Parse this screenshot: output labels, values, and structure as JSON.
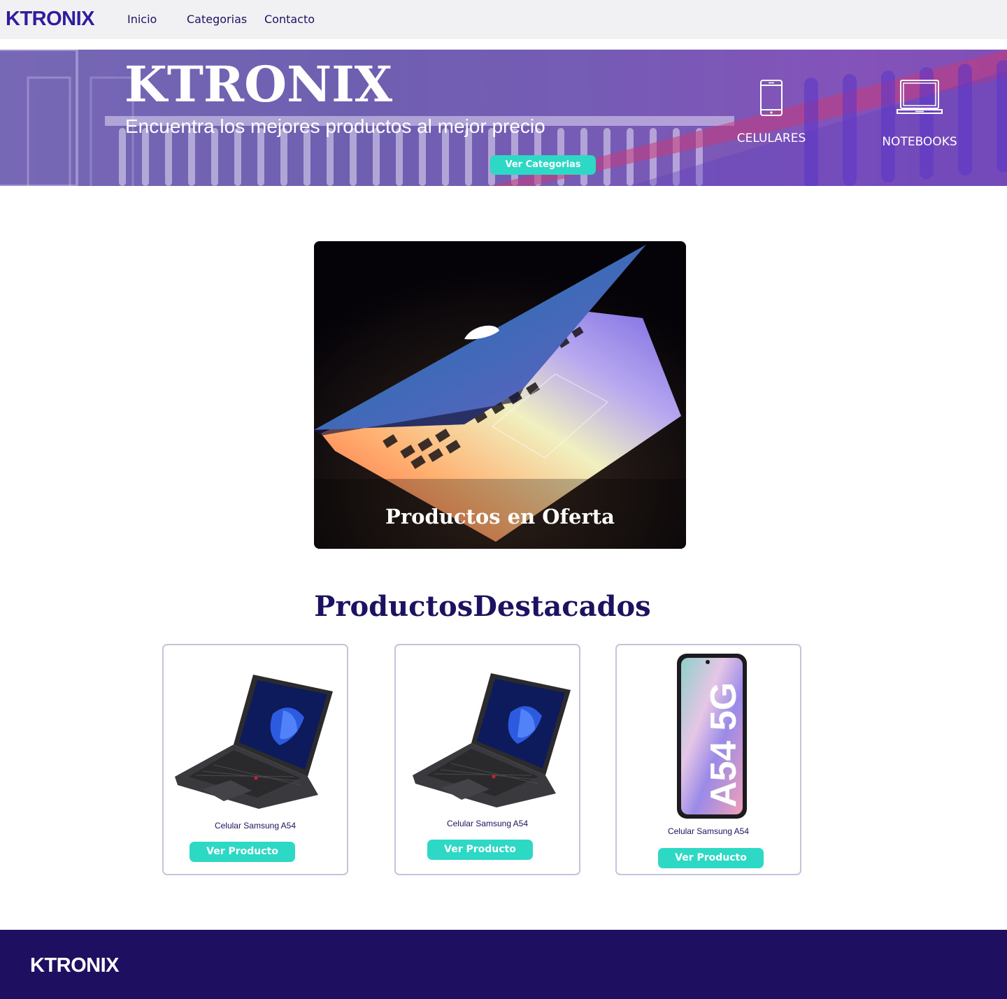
{
  "brand": {
    "logo_text": "KTRONIX",
    "accent_color": "#2e1d9c",
    "teal_color": "#2dd8c4",
    "footer_bg": "#1e0f61"
  },
  "nav": {
    "inicio": "Inicio",
    "categorias": "Categorias",
    "contacto": "Contacto"
  },
  "hero": {
    "title": "KTRONIX",
    "subtitle": "Encuentra los mejores productos al mejor precio",
    "button_label": "Ver Categorias",
    "categories": [
      {
        "label": "CELULARES",
        "icon": "smartphone-icon"
      },
      {
        "label": "NOTEBOOKS",
        "icon": "laptop-icon"
      }
    ]
  },
  "offer": {
    "title": "Productos en Oferta"
  },
  "featured": {
    "title": "ProductosDestacados",
    "products": [
      {
        "name": "Celular Samsung A54",
        "button_label": "Ver Producto",
        "image": "laptop"
      },
      {
        "name": "Celular Samsung A54",
        "button_label": "Ver Producto",
        "image": "laptop"
      },
      {
        "name": "Celular Samsung A54",
        "button_label": "Ver Producto",
        "image": "phone",
        "image_text": "A54 5G"
      }
    ]
  },
  "footer": {
    "logo_text": "KTRONIX"
  }
}
